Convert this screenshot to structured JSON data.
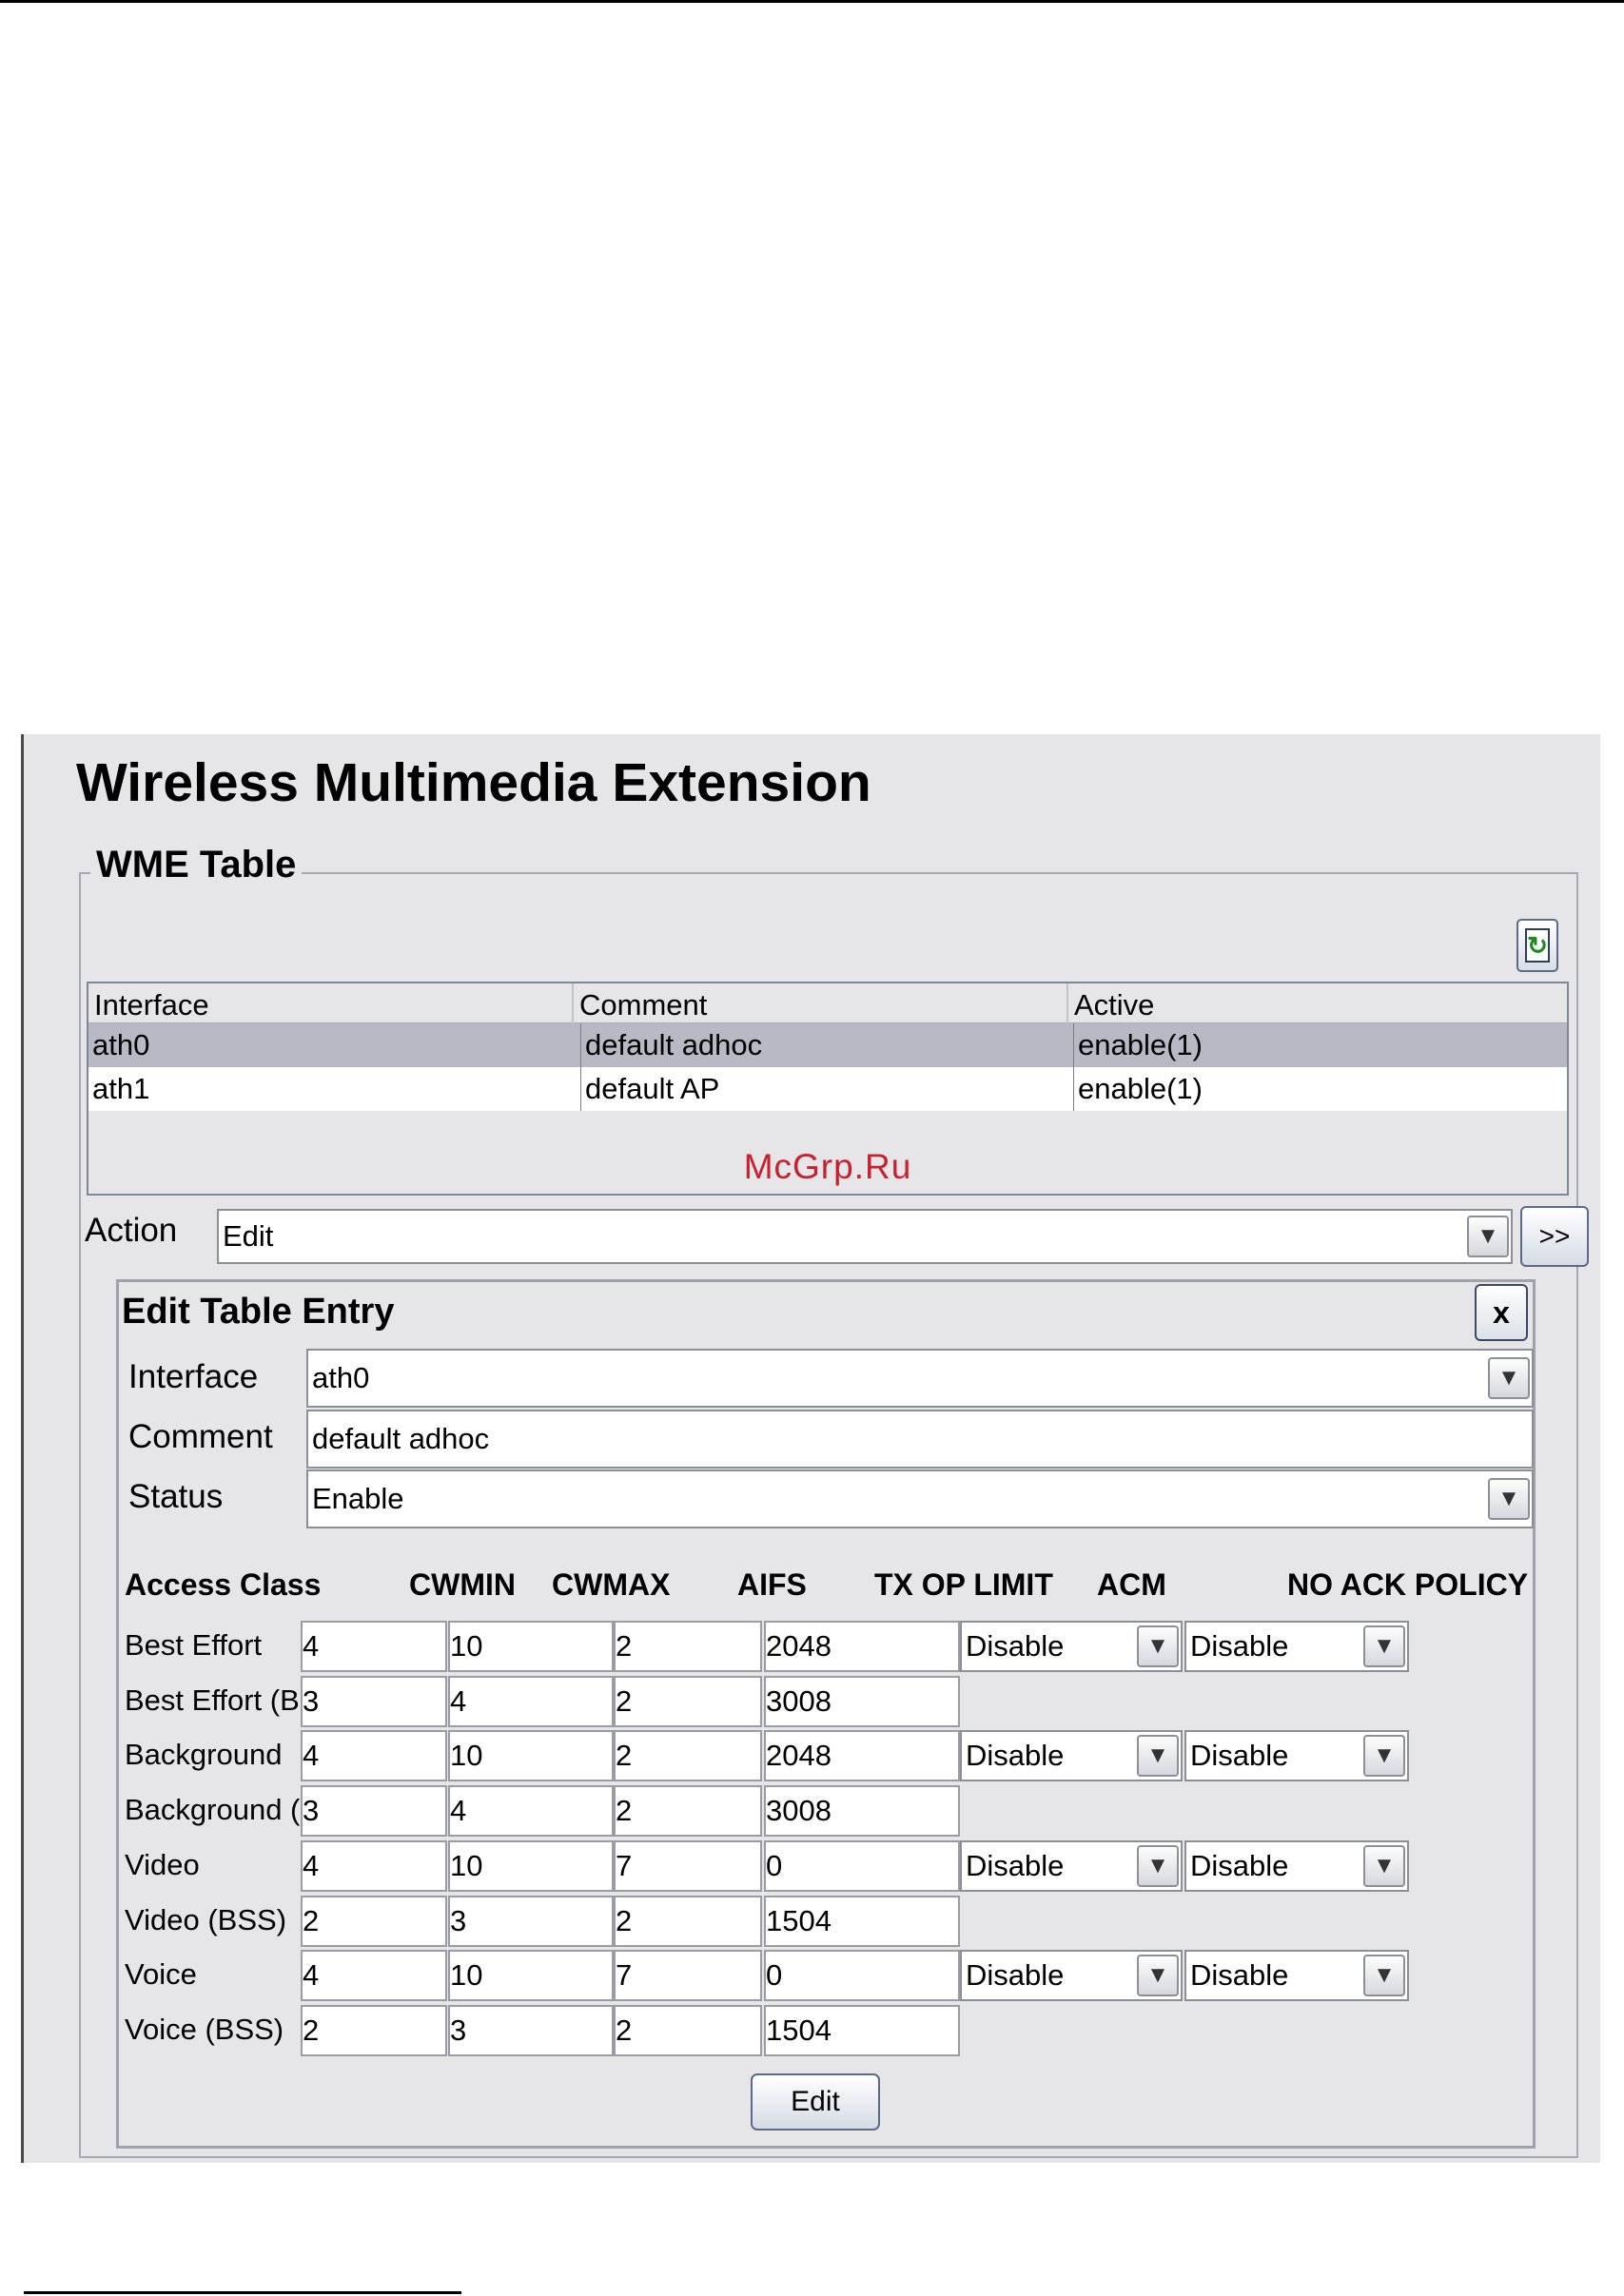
{
  "page": {
    "title": "Wireless Multimedia Extension"
  },
  "wme_table": {
    "legend": "WME Table",
    "columns": [
      "Interface",
      "Comment",
      "Active"
    ],
    "rows": [
      {
        "interface": "ath0",
        "comment": "default adhoc",
        "active": "enable(1)",
        "selected": true
      },
      {
        "interface": "ath1",
        "comment": "default AP",
        "active": "enable(1)",
        "selected": false
      }
    ],
    "watermark": "McGrp.Ru"
  },
  "action": {
    "label": "Action",
    "value": "Edit",
    "go_label": ">>"
  },
  "edit_entry": {
    "title": "Edit Table Entry",
    "close_label": "x",
    "interface_label": "Interface",
    "interface_value": "ath0",
    "comment_label": "Comment",
    "comment_value": "default adhoc",
    "status_label": "Status",
    "status_value": "Enable",
    "headers": {
      "access_class": "Access Class",
      "cwmin": "CWMIN",
      "cwmax": "CWMAX",
      "aifs": "AIFS",
      "txop": "TX OP LIMIT",
      "acm": "ACM",
      "noack": "NO ACK POLICY"
    },
    "classes": [
      {
        "name": "Best Effort",
        "cwmin": "4",
        "cwmax": "10",
        "aifs": "2",
        "txop": "2048",
        "acm": "Disable",
        "noack": "Disable"
      },
      {
        "name": "Best Effort (BSS)",
        "cwmin": "3",
        "cwmax": "4",
        "aifs": "2",
        "txop": "3008"
      },
      {
        "name": "Background",
        "cwmin": "4",
        "cwmax": "10",
        "aifs": "2",
        "txop": "2048",
        "acm": "Disable",
        "noack": "Disable"
      },
      {
        "name": "Background (BSS)",
        "cwmin": "3",
        "cwmax": "4",
        "aifs": "2",
        "txop": "3008"
      },
      {
        "name": "Video",
        "cwmin": "4",
        "cwmax": "10",
        "aifs": "7",
        "txop": "0",
        "acm": "Disable",
        "noack": "Disable"
      },
      {
        "name": "Video (BSS)",
        "cwmin": "2",
        "cwmax": "3",
        "aifs": "2",
        "txop": "1504"
      },
      {
        "name": "Voice",
        "cwmin": "4",
        "cwmax": "10",
        "aifs": "7",
        "txop": "0",
        "acm": "Disable",
        "noack": "Disable"
      },
      {
        "name": "Voice (BSS)",
        "cwmin": "2",
        "cwmax": "3",
        "aifs": "2",
        "txop": "1504"
      }
    ],
    "submit_label": "Edit"
  }
}
